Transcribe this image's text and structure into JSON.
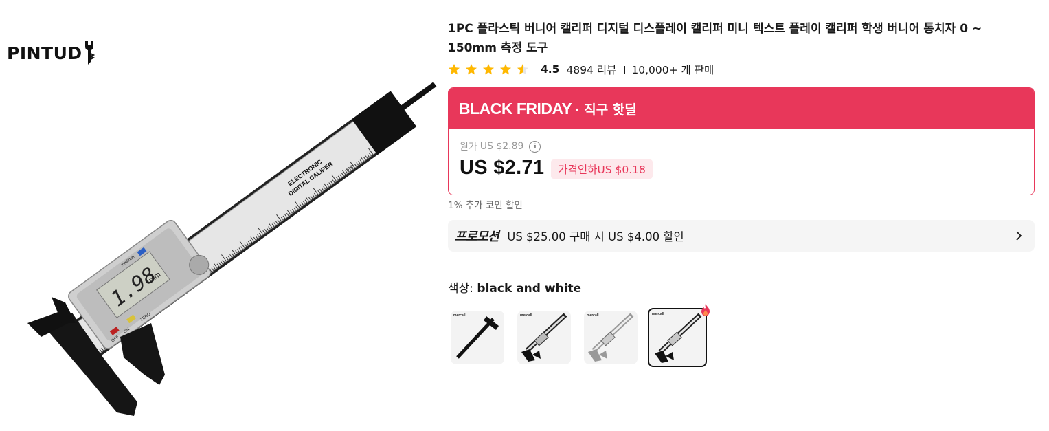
{
  "brand": {
    "logo_text": "PINTUD"
  },
  "caliper_markings": {
    "label_line1": "ELECTRONIC",
    "label_line2": "DIGITAL CALIPER",
    "unit_mm": "mm",
    "display_value": "1.98",
    "display_unit": "mm",
    "button_mode": "mm/inch",
    "button_off": "OFF",
    "button_on": "ON",
    "button_zero": "ZERO"
  },
  "product": {
    "title": "1PC 플라스틱 버니어 캘리퍼 디지털 디스플레이 캘리퍼 미니 텍스트 플레이 캘리퍼 학생 버니어 통치자 0 ~ 150mm 측정 도구",
    "rating": "4.5",
    "rating_stars": 4.5,
    "reviews": "4894 리뷰",
    "sold": "10,000+ 개 판매"
  },
  "deal": {
    "banner_title": "BLACK FRIDAY",
    "banner_subtitle": "· 직구 핫딜",
    "original_label": "원가",
    "original_price": "US $2.89",
    "info_icon": "i",
    "current_price": "US $2.71",
    "discount": "가격인하US $0.18",
    "banner_color": "#e8375a"
  },
  "coin_note": "1% 추가 코인 할인",
  "promotion": {
    "tag": "프로모션",
    "text": "US $25.00 구매 시 US $4.00 할인"
  },
  "color_selector": {
    "label": "색상:",
    "value": "black and white",
    "options": [
      {
        "name": "black",
        "brand_mark": "mercall",
        "selected": false
      },
      {
        "name": "black and silver",
        "brand_mark": "mercall",
        "selected": false
      },
      {
        "name": "silver",
        "brand_mark": "mercall",
        "selected": false
      },
      {
        "name": "black and white",
        "brand_mark": "mercall",
        "selected": true
      }
    ]
  },
  "colors": {
    "accent": "#e8375a",
    "star": "#ffb800",
    "text": "#191919"
  }
}
